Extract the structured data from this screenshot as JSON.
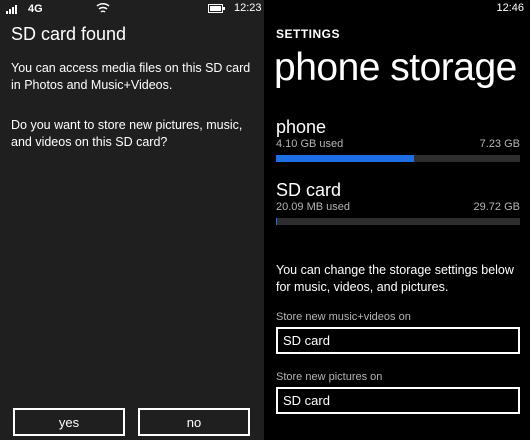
{
  "dialog_screen": {
    "status_bar": {
      "network": "4G",
      "time": "12:23",
      "icons": [
        "signal-icon",
        "wifi-icon",
        "battery-icon"
      ]
    },
    "title": "SD card found",
    "paragraph1": "You can access media files on this SD card in Photos and Music+Videos.",
    "paragraph2": "Do you want to store new pictures, music, and videos on this SD card?",
    "buttons": {
      "yes": "yes",
      "no": "no"
    }
  },
  "storage_screen": {
    "status_bar": {
      "time": "12:46"
    },
    "app_title": "SETTINGS",
    "page_title": "phone storage",
    "items": [
      {
        "name": "phone",
        "used": "4.10 GB used",
        "total": "7.23 GB",
        "fraction_used": 0.567
      },
      {
        "name": "SD card",
        "used": "20.09 MB used",
        "total": "29.72 GB",
        "fraction_used": 0.0007
      }
    ],
    "info": "You can change the storage settings below for music, videos, and pictures.",
    "settings": [
      {
        "label": "Store new music+videos on",
        "value": "SD card"
      },
      {
        "label": "Store new pictures on",
        "value": "SD card"
      }
    ],
    "colors": {
      "accent": "#1e6fe6",
      "bar_track": "#2e2e2e"
    }
  }
}
